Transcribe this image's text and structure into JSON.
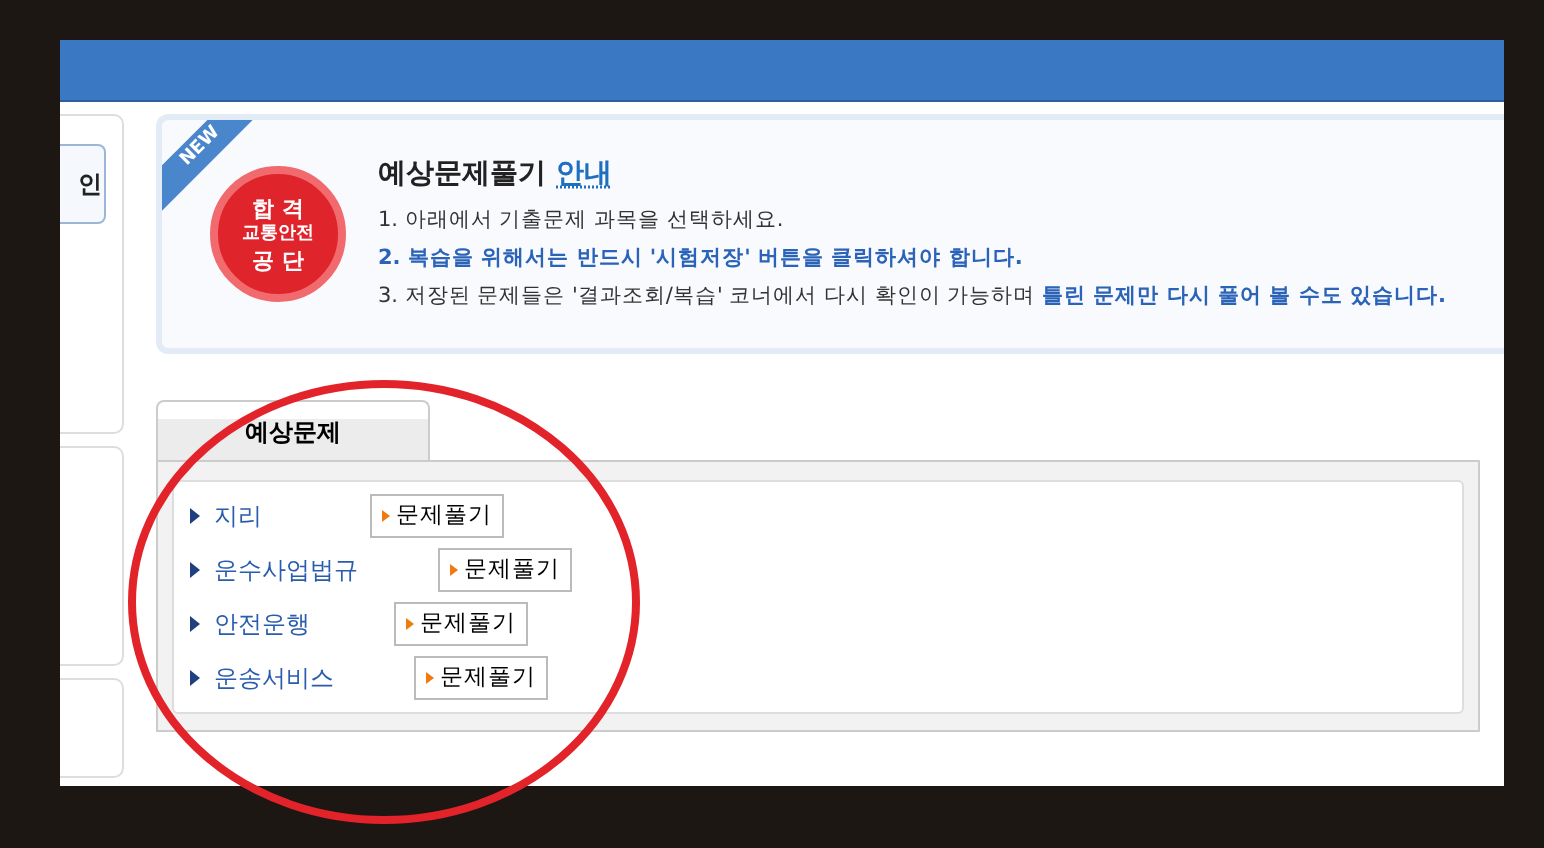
{
  "sidebar": {
    "button": "인"
  },
  "notice": {
    "ribbon": "NEW",
    "seal": [
      "합 격",
      "교통안전",
      "공 단"
    ],
    "title": "예상문제풀기",
    "title_highlight": "안내",
    "lines": [
      {
        "kind": "plain",
        "text": "1. 아래에서 기출문제 과목을 선택하세요."
      },
      {
        "kind": "emphasis",
        "text": "2. 복습을 위해서는 반드시 '시험저장' 버튼을 클릭하셔야 합니다."
      },
      {
        "kind": "mixed",
        "text": "3. 저장된 문제들은 '결과조회/복습' 코너에서 다시 확인이 가능하며",
        "highlight": "틀린 문제만 다시 풀어 볼 수도 있습니다."
      }
    ]
  },
  "tabs": [
    {
      "label": "예상문제",
      "selected": true
    }
  ],
  "subjects": [
    {
      "name": "지리",
      "button": "문제풀기"
    },
    {
      "name": "운수사업법규",
      "button": "문제풀기"
    },
    {
      "name": "안전운행",
      "button": "문제풀기"
    },
    {
      "name": "운송서비스",
      "button": "문제풀기"
    }
  ]
}
